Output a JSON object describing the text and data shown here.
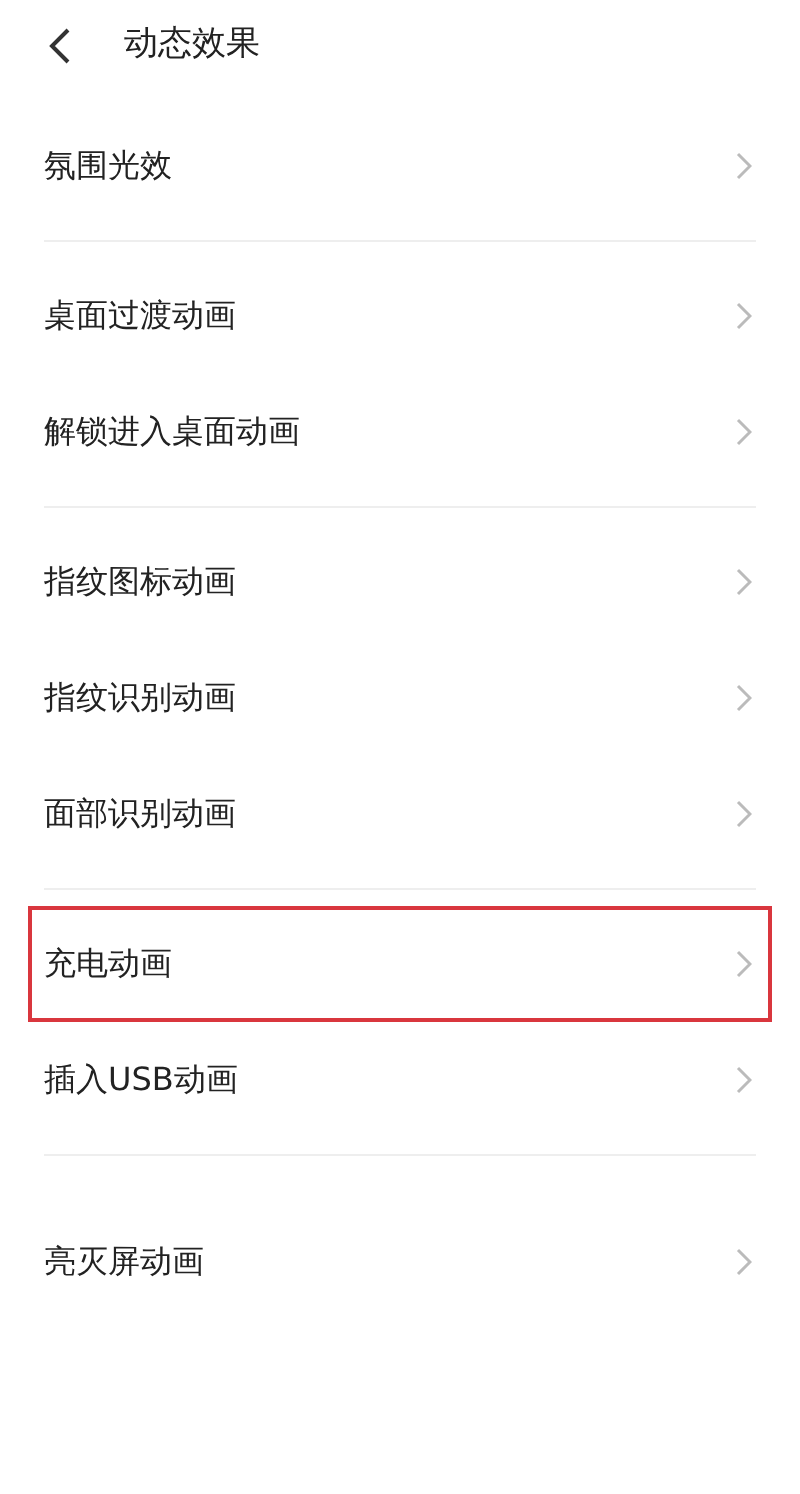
{
  "header": {
    "title": "动态效果"
  },
  "sections": [
    {
      "items": [
        {
          "label": "氛围光效",
          "highlighted": false
        }
      ]
    },
    {
      "items": [
        {
          "label": "桌面过渡动画",
          "highlighted": false
        },
        {
          "label": "解锁进入桌面动画",
          "highlighted": false
        }
      ]
    },
    {
      "items": [
        {
          "label": "指纹图标动画",
          "highlighted": false
        },
        {
          "label": "指纹识别动画",
          "highlighted": false
        },
        {
          "label": "面部识别动画",
          "highlighted": false
        }
      ]
    },
    {
      "items": [
        {
          "label": "充电动画",
          "highlighted": true
        },
        {
          "label": "插入USB动画",
          "highlighted": false
        }
      ]
    },
    {
      "items": [
        {
          "label": "亮灭屏动画",
          "highlighted": false
        }
      ]
    }
  ]
}
